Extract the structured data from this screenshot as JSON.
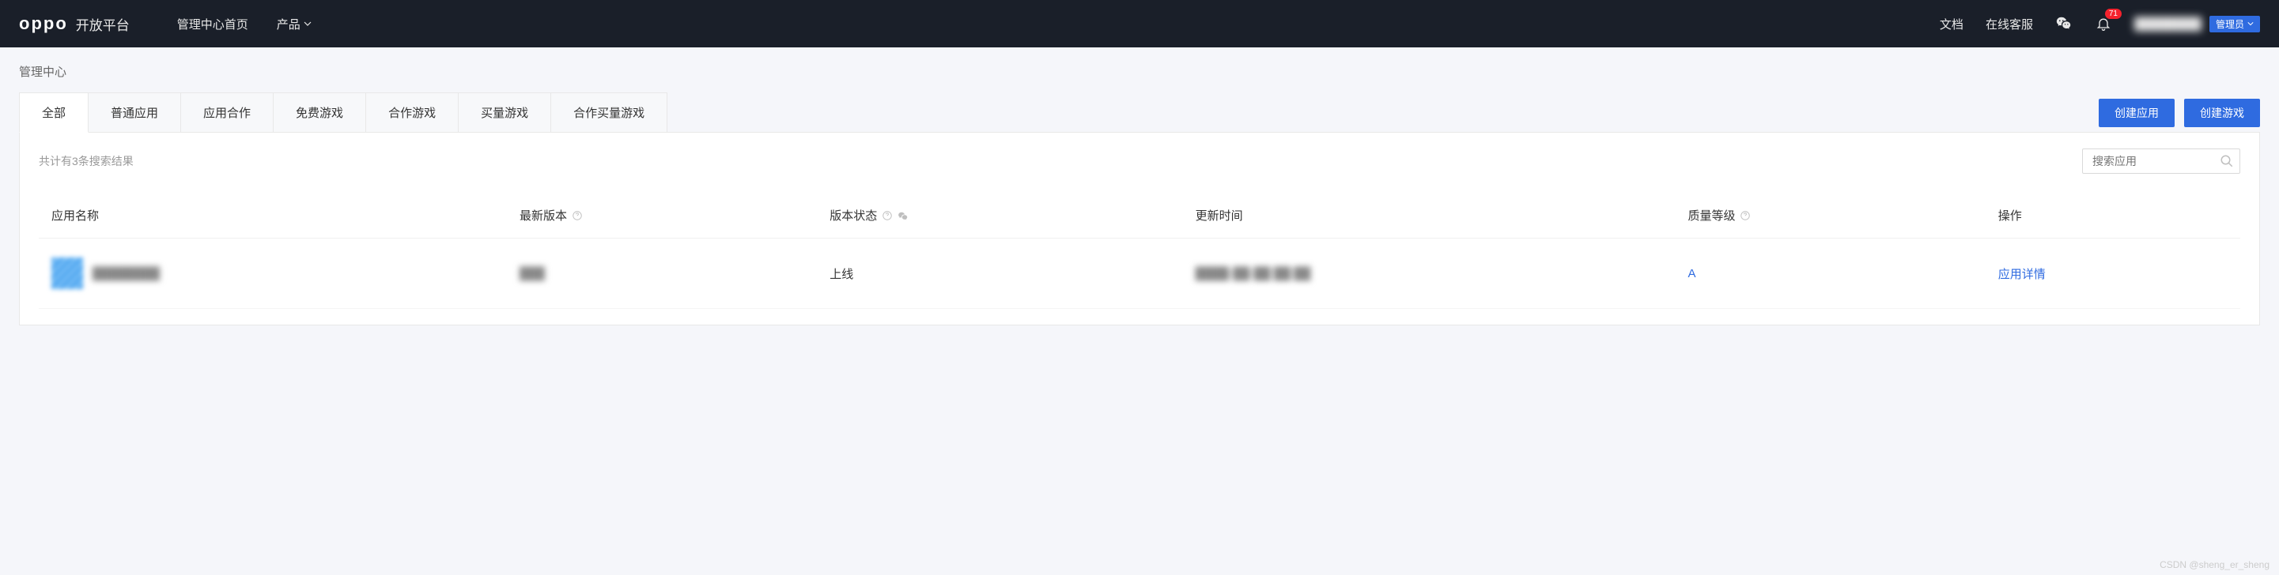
{
  "header": {
    "brand": "oppo",
    "brand_sub": "开放平台",
    "nav": {
      "home": "管理中心首页",
      "products": "产品"
    },
    "right": {
      "docs": "文档",
      "support": "在线客服",
      "notification_count": "71",
      "username": "████████",
      "role": "管理员"
    }
  },
  "breadcrumb": "管理中心",
  "tabs": [
    {
      "label": "全部",
      "active": true
    },
    {
      "label": "普通应用",
      "active": false
    },
    {
      "label": "应用合作",
      "active": false
    },
    {
      "label": "免费游戏",
      "active": false
    },
    {
      "label": "合作游戏",
      "active": false
    },
    {
      "label": "买量游戏",
      "active": false
    },
    {
      "label": "合作买量游戏",
      "active": false
    }
  ],
  "actions": {
    "create_app": "创建应用",
    "create_game": "创建游戏"
  },
  "filter": {
    "result_text": "共计有3条搜索结果",
    "search_placeholder": "搜索应用"
  },
  "table": {
    "headers": {
      "app_name": "应用名称",
      "latest_version": "最新版本",
      "version_status": "版本状态",
      "update_time": "更新时间",
      "quality_level": "质量等级",
      "action": "操作"
    },
    "rows": [
      {
        "app_name": "████████",
        "latest_version": "███",
        "version_status": "上线",
        "update_time": "████-██-██ ██:██",
        "quality_level": "A",
        "action_label": "应用详情"
      }
    ]
  },
  "watermark": "CSDN @sheng_er_sheng"
}
